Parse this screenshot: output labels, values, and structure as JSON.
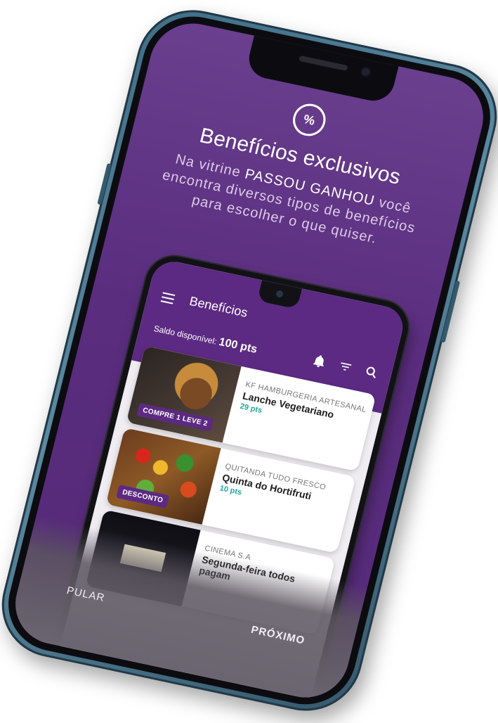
{
  "hero": {
    "title": "Benefícios exclusivos",
    "desc_pre": "Na vitrine ",
    "desc_brand": "PASSOU GANHOU",
    "desc_post": " você encontra diversos tipos de benefícios para escolher o que quiser.",
    "icon": "discount-badge-icon"
  },
  "app": {
    "title": "Benefícios",
    "saldo_label": "Saldo disponível:",
    "saldo_value": "100 pts",
    "icons": [
      "menu-icon",
      "bell-icon",
      "filter-icon",
      "search-icon"
    ]
  },
  "cards": [
    {
      "store": "KF HAMBURGERIA ARTESANAL",
      "name": "Lanche Vegetariano",
      "pts": "29 pts",
      "tag": "COMPRE 1 LEVE 2"
    },
    {
      "store": "QUITANDA TUDO FRESCO",
      "name": "Quinta do Hortifruti",
      "pts": "10 pts",
      "tag": "DESCONTO"
    },
    {
      "store": "CINEMA S.A",
      "name": "Segunda-feira todos pagam",
      "pts": "",
      "tag": ""
    }
  ],
  "nav": {
    "skip": "PULAR",
    "next": "PRÓXIMO"
  },
  "colors": {
    "primary": "#5c2a82",
    "accent": "#1fa99a",
    "frame": "#3f6e86"
  }
}
